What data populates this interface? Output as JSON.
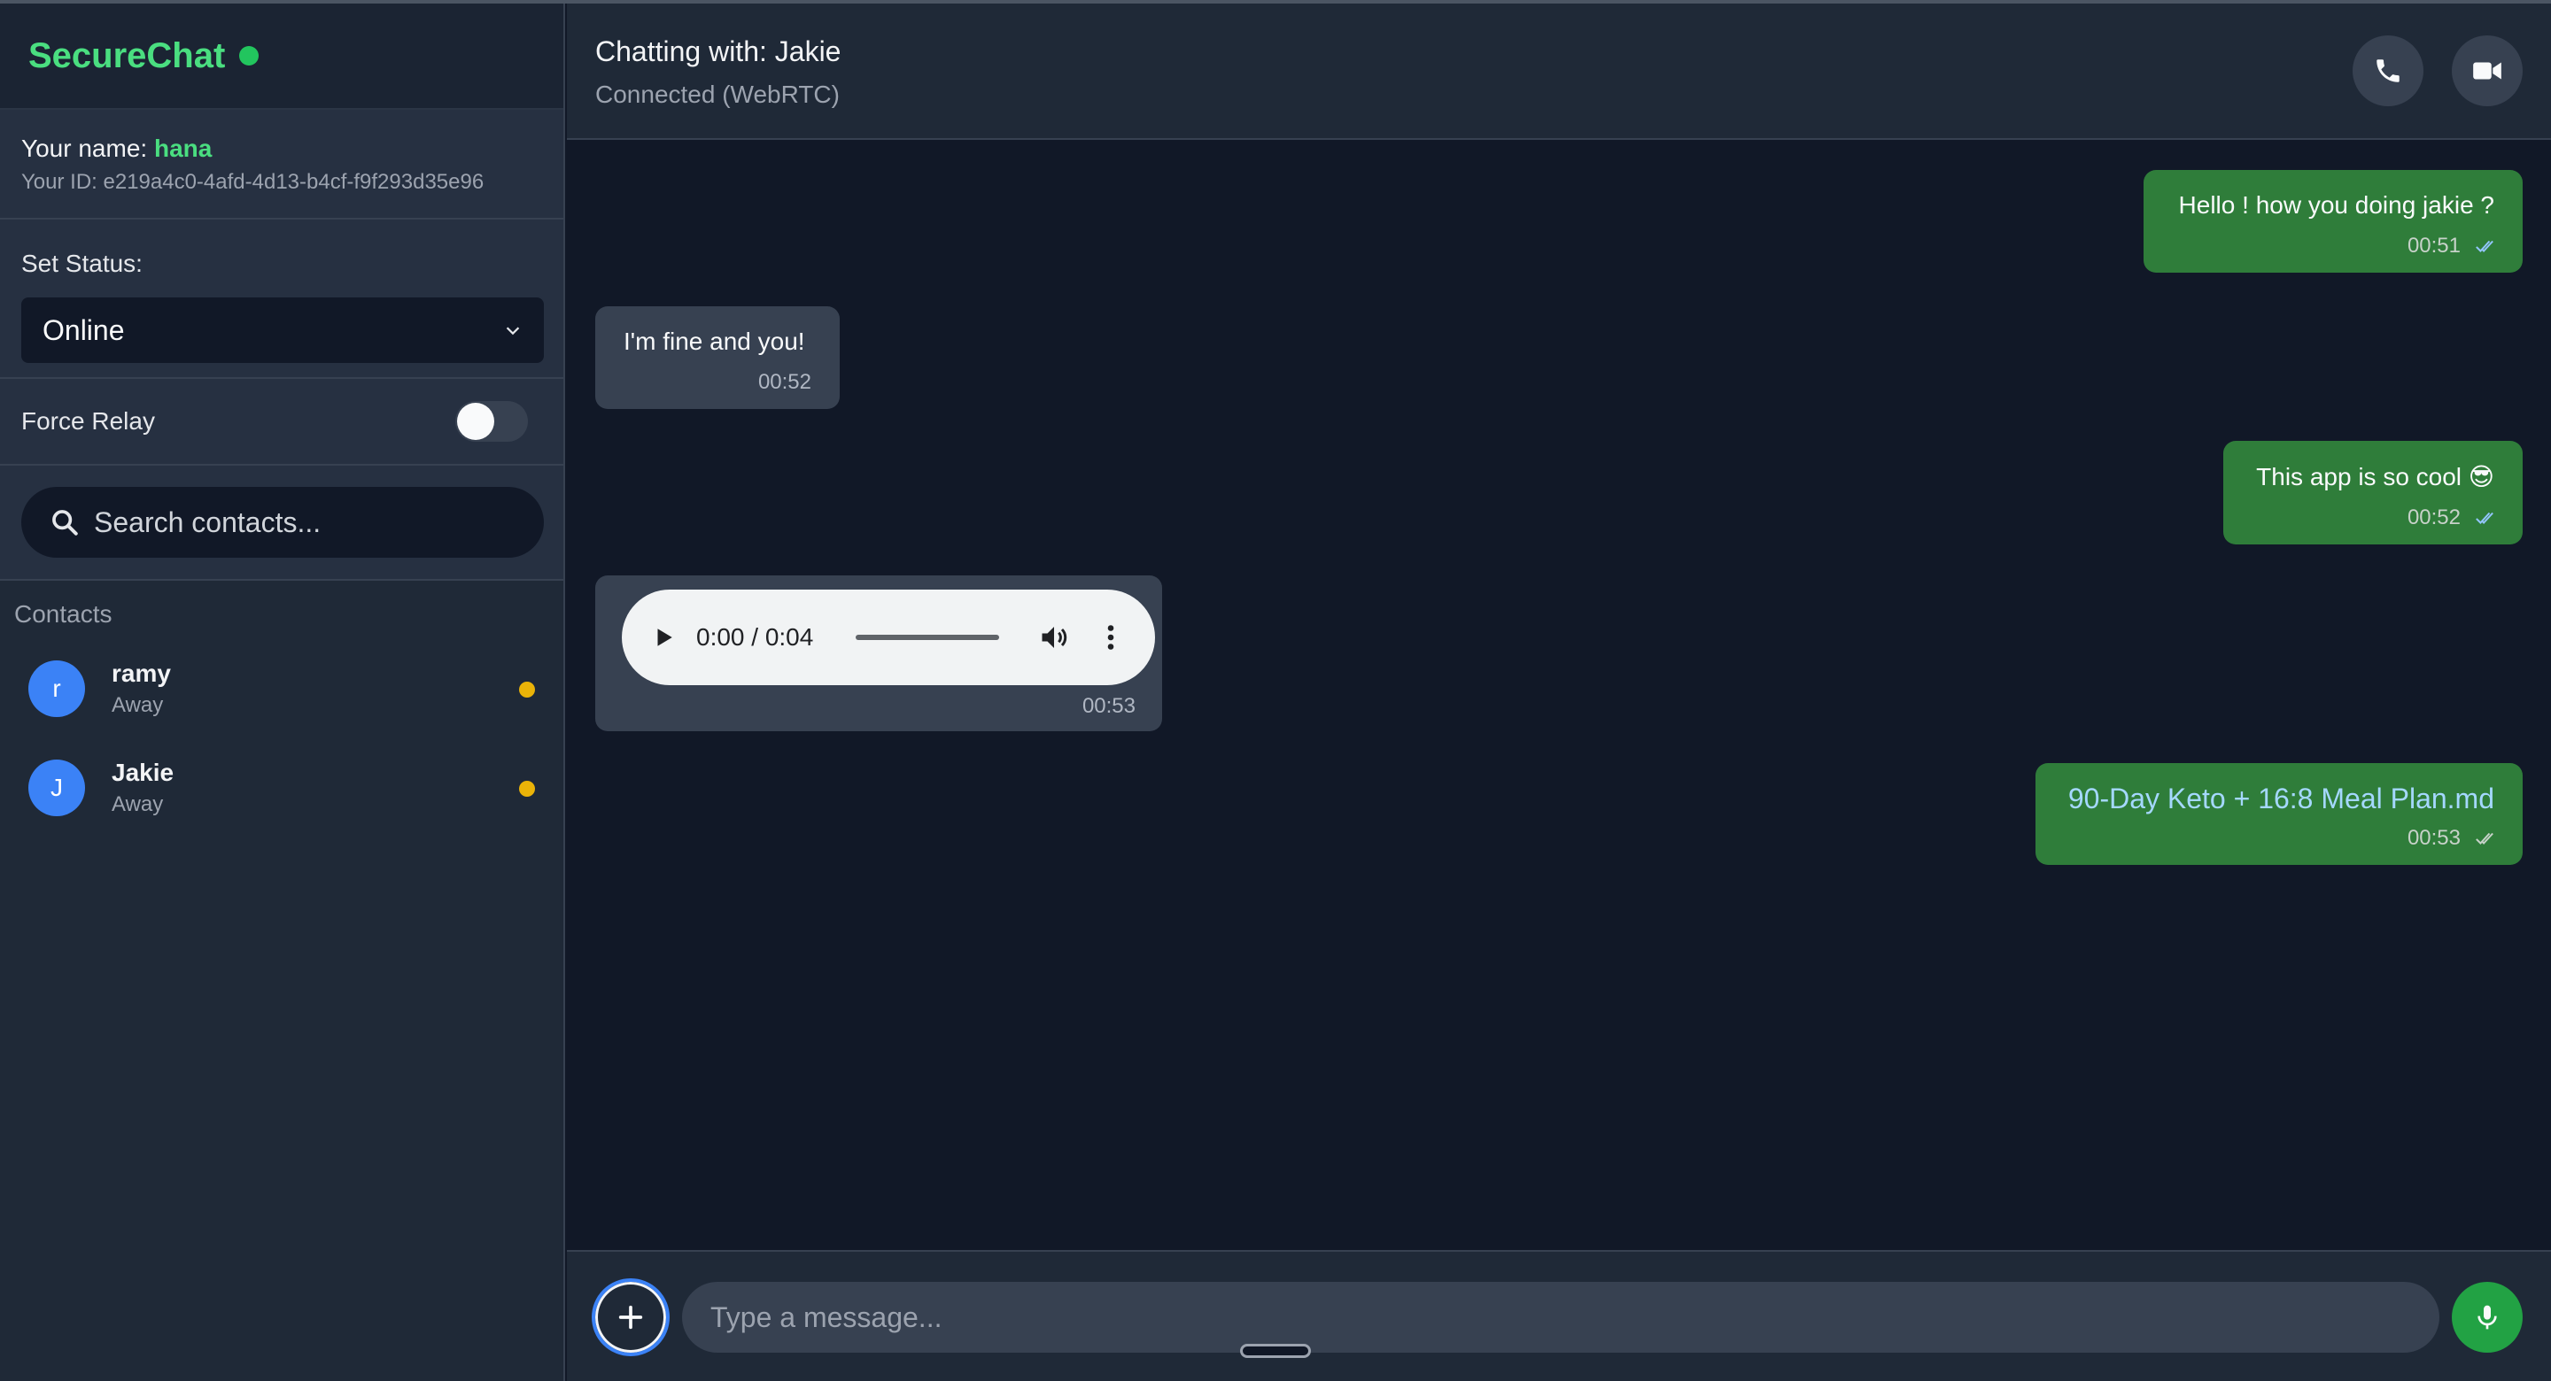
{
  "app": {
    "name": "SecureChat"
  },
  "user": {
    "name_label": "Your name:",
    "name": "hana",
    "id_label": "Your ID:",
    "id": "e219a4c0-4afd-4d13-b4cf-f9f293d35e96"
  },
  "status": {
    "label": "Set Status:",
    "value": "Online"
  },
  "relay": {
    "label": "Force Relay",
    "enabled": false
  },
  "search": {
    "placeholder": "Search contacts..."
  },
  "contacts": {
    "title": "Contacts",
    "items": [
      {
        "initial": "r",
        "name": "ramy",
        "status": "Away"
      },
      {
        "initial": "J",
        "name": "Jakie",
        "status": "Away"
      }
    ]
  },
  "chat": {
    "title": "Chatting with: Jakie",
    "subtitle": "Connected (WebRTC)",
    "messages": [
      {
        "direction": "sent",
        "text": "Hello ! how you doing jakie ?",
        "time": "00:51"
      },
      {
        "direction": "received",
        "text": "I'm fine and you!",
        "time": "00:52"
      },
      {
        "direction": "sent",
        "text": "This app is so cool 😎",
        "time": "00:52"
      },
      {
        "direction": "received",
        "audio_time": "0:00 / 0:04",
        "time": "00:53"
      },
      {
        "direction": "sent",
        "file": "90-Day Keto + 16:8 Meal Plan.md",
        "time": "00:53"
      }
    ]
  },
  "composer": {
    "placeholder": "Type a message..."
  },
  "colors": {
    "accent_green": "#4ade80",
    "sent_bubble": "#2f7d3a",
    "received_bubble": "#374151",
    "away": "#eab308",
    "avatar": "#3b82f6"
  }
}
